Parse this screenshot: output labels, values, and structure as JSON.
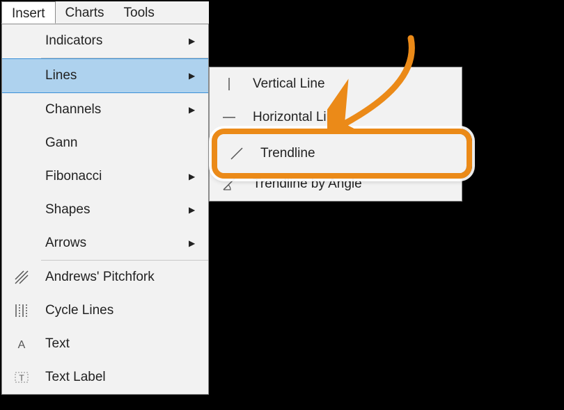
{
  "menubar": {
    "items": [
      {
        "label": "Insert",
        "active": true
      },
      {
        "label": "Charts",
        "active": false
      },
      {
        "label": "Tools",
        "active": false
      }
    ]
  },
  "insert_menu": {
    "items": [
      {
        "label": "Indicators",
        "has_sub": true
      },
      {
        "label": "Lines",
        "has_sub": true,
        "highlighted": true
      },
      {
        "label": "Channels",
        "has_sub": true
      },
      {
        "label": "Gann",
        "has_sub": false
      },
      {
        "label": "Fibonacci",
        "has_sub": true
      },
      {
        "label": "Shapes",
        "has_sub": true
      },
      {
        "label": "Arrows",
        "has_sub": true
      }
    ],
    "bottom_items": [
      {
        "label": "Andrews' Pitchfork",
        "icon": "pitchfork-icon"
      },
      {
        "label": "Cycle Lines",
        "icon": "cycle-lines-icon"
      },
      {
        "label": "Text",
        "icon": "text-icon"
      },
      {
        "label": "Text Label",
        "icon": "text-label-icon"
      }
    ]
  },
  "lines_submenu": {
    "items": [
      {
        "label": "Vertical Line",
        "icon": "vertical-line-icon"
      },
      {
        "label": "Horizontal Line",
        "icon": "horizontal-line-icon"
      },
      {
        "label": "Trendline",
        "icon": "trendline-icon",
        "emphasized": true
      },
      {
        "label": "Trendline by Angle",
        "icon": "trendline-angle-icon"
      }
    ]
  },
  "annotation": {
    "highlight_target": "Trendline",
    "highlight_color": "#eb8a18"
  }
}
